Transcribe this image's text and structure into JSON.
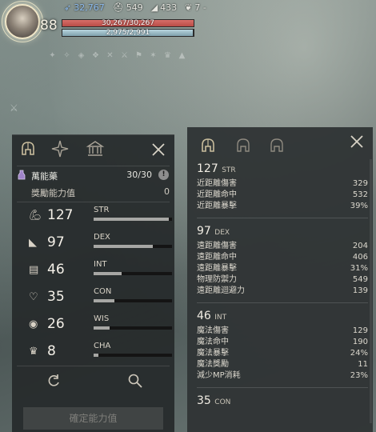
{
  "hud": {
    "level": "88",
    "top_stats": [
      {
        "icon": "feather-icon",
        "value": "32,767",
        "color": "#8fbdf0"
      },
      {
        "icon": "helmet-icon",
        "value": "549"
      },
      {
        "icon": "boot-icon",
        "value": "433"
      },
      {
        "icon": "wing-icon",
        "value": "7 -"
      }
    ],
    "hp": {
      "text": "30,267/30,267",
      "fraction": 1.0
    },
    "mp": {
      "text": "2,975/2,991",
      "fraction": 0.9946
    }
  },
  "left_panel": {
    "tabs": [
      "helmet-icon",
      "compass-star-icon",
      "temple-icon"
    ],
    "potion": {
      "label": "萬能藥",
      "value": "30/30"
    },
    "bonus": {
      "label": "獎勵能力值",
      "value": "0"
    },
    "stats": [
      {
        "key": "str",
        "icon": "arm-icon",
        "value": "127",
        "name": "STR",
        "fraction": 0.96
      },
      {
        "key": "dex",
        "icon": "boot-icon",
        "value": "97",
        "name": "DEX",
        "fraction": 0.76
      },
      {
        "key": "int",
        "icon": "book-icon",
        "value": "46",
        "name": "INT",
        "fraction": 0.36
      },
      {
        "key": "con",
        "icon": "heart-icon",
        "value": "35",
        "name": "CON",
        "fraction": 0.27
      },
      {
        "key": "wis",
        "icon": "eye-icon",
        "value": "26",
        "name": "WIS",
        "fraction": 0.2
      },
      {
        "key": "cha",
        "icon": "crown-icon",
        "value": "8",
        "name": "CHA",
        "fraction": 0.06
      }
    ],
    "confirm_label": "確定能力值"
  },
  "right_panel": {
    "sections": [
      {
        "value": "127",
        "stat": "STR",
        "rows": [
          {
            "label": "近距離傷害",
            "value": "329"
          },
          {
            "label": "近距離命中",
            "value": "532"
          },
          {
            "label": "近距離暴擊",
            "value": "39%"
          }
        ]
      },
      {
        "value": "97",
        "stat": "DEX",
        "rows": [
          {
            "label": "遠距離傷害",
            "value": "204"
          },
          {
            "label": "遠距離命中",
            "value": "406"
          },
          {
            "label": "遠距離暴擊",
            "value": "31%"
          },
          {
            "label": "物理防禦力",
            "value": "549"
          },
          {
            "label": "遠距離迴避力",
            "value": "139"
          }
        ]
      },
      {
        "value": "46",
        "stat": "INT",
        "rows": [
          {
            "label": "魔法傷害",
            "value": "129"
          },
          {
            "label": "魔法命中",
            "value": "190"
          },
          {
            "label": "魔法暴擊",
            "value": "24%"
          },
          {
            "label": "魔法獎勵",
            "value": "11"
          },
          {
            "label": "減少MP消耗",
            "value": "23%"
          }
        ]
      },
      {
        "value": "35",
        "stat": "CON",
        "rows": []
      }
    ]
  },
  "colors": {
    "hp": "#c25a55",
    "mp": "#9dbfca",
    "panel": "#2a2e2f",
    "accent_blue": "#8fbdf0"
  }
}
